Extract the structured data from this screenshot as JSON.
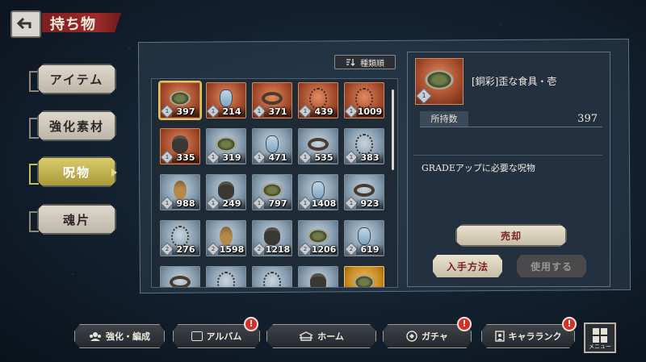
{
  "header": {
    "back_icon": "back-arrow-icon",
    "title": "持ち物"
  },
  "side_menu": {
    "items": [
      {
        "label": "アイテム",
        "active": false
      },
      {
        "label": "強化素材",
        "active": false
      },
      {
        "label": "呪物",
        "active": true
      },
      {
        "label": "魂片",
        "active": false
      }
    ]
  },
  "toolbar": {
    "sort_label": "種類順",
    "sort_icon": "sort-icon"
  },
  "inventory": {
    "items": [
      {
        "kind": "dish",
        "frame": "copper",
        "count": "397",
        "grade": "1",
        "selected": true
      },
      {
        "kind": "bottle",
        "frame": "copper",
        "count": "214",
        "grade": "1"
      },
      {
        "kind": "ring",
        "frame": "copper",
        "count": "371",
        "grade": "1"
      },
      {
        "kind": "necklace",
        "frame": "copper",
        "count": "439",
        "grade": "1"
      },
      {
        "kind": "necklace",
        "frame": "copper",
        "count": "1009",
        "grade": "1"
      },
      {
        "kind": "jar",
        "frame": "copper",
        "count": "335",
        "grade": "1"
      },
      {
        "kind": "dish",
        "frame": "silver",
        "count": "319",
        "grade": "1"
      },
      {
        "kind": "bottle",
        "frame": "silver",
        "count": "471",
        "grade": "1"
      },
      {
        "kind": "ring",
        "frame": "silver",
        "count": "535",
        "grade": "1"
      },
      {
        "kind": "necklace",
        "frame": "silver",
        "count": "383",
        "grade": "1"
      },
      {
        "kind": "gourd",
        "frame": "silver",
        "count": "988",
        "grade": "1"
      },
      {
        "kind": "jar",
        "frame": "silver",
        "count": "249",
        "grade": "1"
      },
      {
        "kind": "dish",
        "frame": "silver",
        "count": "797",
        "grade": "1"
      },
      {
        "kind": "bottle",
        "frame": "silver",
        "count": "1408",
        "grade": "1"
      },
      {
        "kind": "ring",
        "frame": "silver",
        "count": "923",
        "grade": "1"
      },
      {
        "kind": "necklace",
        "frame": "silver",
        "count": "276",
        "grade": "2"
      },
      {
        "kind": "gourd",
        "frame": "silver",
        "count": "1598",
        "grade": "2"
      },
      {
        "kind": "jar",
        "frame": "silver",
        "count": "1218",
        "grade": "2"
      },
      {
        "kind": "dish",
        "frame": "silver",
        "count": "1206",
        "grade": "2"
      },
      {
        "kind": "bottle",
        "frame": "silver",
        "count": "619",
        "grade": "2"
      },
      {
        "kind": "ring",
        "frame": "silver",
        "count": "",
        "grade": ""
      },
      {
        "kind": "necklace",
        "frame": "silver",
        "count": "",
        "grade": ""
      },
      {
        "kind": "necklace",
        "frame": "silver",
        "count": "",
        "grade": ""
      },
      {
        "kind": "jar",
        "frame": "silver",
        "count": "",
        "grade": ""
      },
      {
        "kind": "dish",
        "frame": "gold",
        "count": "",
        "grade": ""
      }
    ]
  },
  "detail": {
    "item_name": "[銅彩]歪な食具・壱",
    "grade": "1",
    "own_label": "所持数",
    "own_value": "397",
    "description": "GRADEアップに必要な呪物",
    "sell_label": "売却",
    "how_to_get_label": "入手方法",
    "use_label": "使用する"
  },
  "bottom_nav": {
    "items": [
      {
        "label": "強化・編成",
        "icon": "party-icon",
        "badge": ""
      },
      {
        "label": "アルバム",
        "icon": "album-icon",
        "badge": "!"
      },
      {
        "label": "ホーム",
        "icon": "home-icon",
        "badge": ""
      },
      {
        "label": "ガチャ",
        "icon": "gacha-icon",
        "badge": "!"
      },
      {
        "label": "キャラランク",
        "icon": "rank-icon",
        "badge": "!"
      }
    ],
    "menu_label": "メニュー"
  },
  "colors": {
    "copper": "#a24a2a",
    "silver": "#7f96a8",
    "gold": "#c4851e",
    "accent_active": "#d9cc6c",
    "badge": "#d4302a"
  }
}
